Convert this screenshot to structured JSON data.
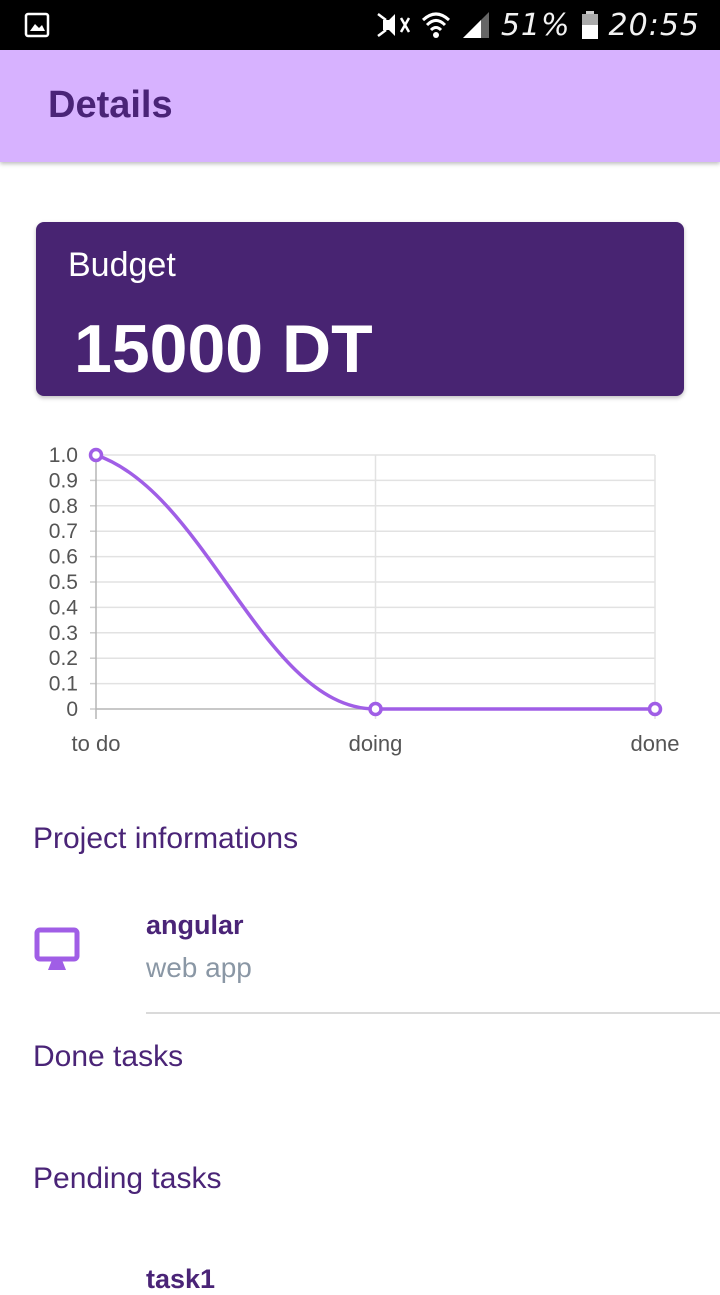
{
  "status_bar": {
    "battery": "51%",
    "time": "20:55",
    "icons": [
      "gallery-icon",
      "mute-icon",
      "wifi-icon",
      "signal-icon",
      "battery-icon"
    ]
  },
  "app_bar": {
    "title": "Details"
  },
  "budget": {
    "label": "Budget",
    "value": "15000 DT"
  },
  "chart_data": {
    "type": "line",
    "categories": [
      "to do",
      "doing",
      "done"
    ],
    "series": [
      {
        "values": [
          1.0,
          0,
          0
        ]
      }
    ],
    "ylim": [
      0,
      1.0
    ],
    "yticks": [
      "0",
      "0.1",
      "0.2",
      "0.3",
      "0.4",
      "0.5",
      "0.6",
      "0.7",
      "0.8",
      "0.9",
      "1.0"
    ],
    "grid": true,
    "color": "#a05ee6"
  },
  "project_section": {
    "title": "Project informations"
  },
  "project_item": {
    "name": "angular",
    "type": "web app",
    "icon": "monitor-icon"
  },
  "done_section": {
    "title": "Done tasks"
  },
  "pending_section": {
    "title": "Pending tasks"
  },
  "pending_items": [
    {
      "name": "task1"
    }
  ],
  "colors": {
    "app_bar": "#d7b2ff",
    "primary_dark": "#482472",
    "accent": "#a05ee6",
    "subtitle": "#8a97a5"
  }
}
